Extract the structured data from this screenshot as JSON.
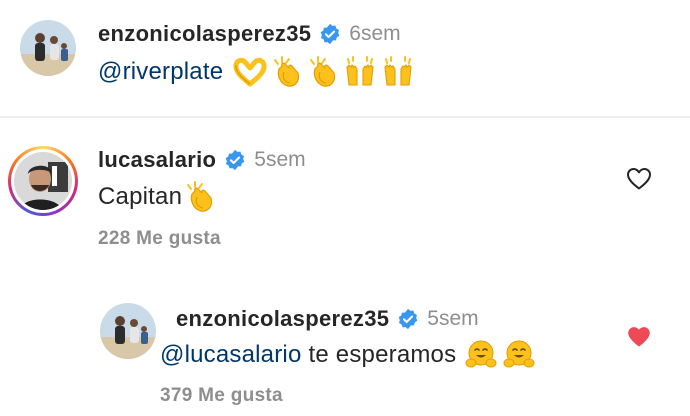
{
  "comment1": {
    "username": "enzonicolasperez35",
    "time": "6sem",
    "mention": "@riverplate",
    "emojis": [
      "heart-hands-emoji",
      "clapping-hands-emoji",
      "clapping-hands-emoji",
      "raising-hands-emoji",
      "raising-hands-emoji"
    ]
  },
  "comment2": {
    "username": "lucasalario",
    "time": "5sem",
    "text": "Capitan",
    "emojis": [
      "clapping-hands-emoji"
    ],
    "likes": "228 Me gusta",
    "liked": false
  },
  "reply": {
    "username": "enzonicolasperez35",
    "time": "5sem",
    "mention": "@lucasalario",
    "text": "te esperamos",
    "emojis": [
      "hugging-face-emoji",
      "hugging-face-emoji"
    ],
    "likes": "379 Me gusta",
    "liked": true
  },
  "colors": {
    "verified_blue": "#3897f0",
    "mention_blue": "#00376b",
    "like_red": "#ed4956",
    "muted_gray": "#8e8e8e",
    "emoji_yellow": "#fcc21b"
  }
}
